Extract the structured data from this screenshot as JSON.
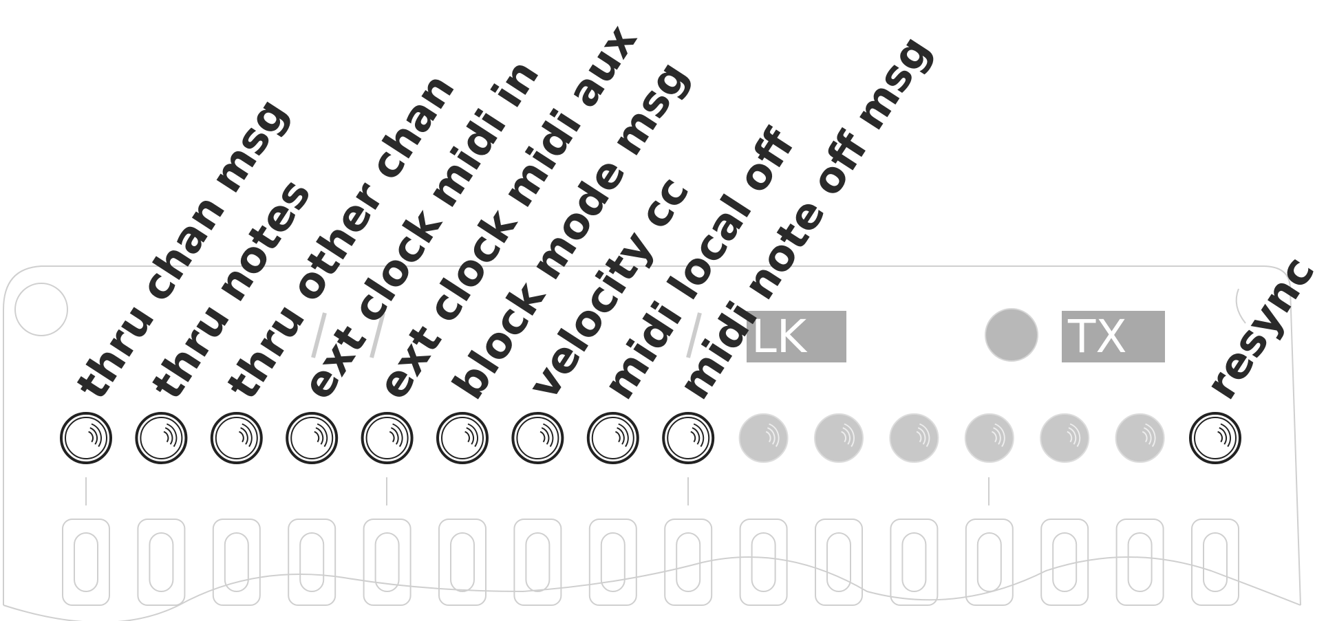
{
  "colors": {
    "outline": "#cfcfcf",
    "active_ring": "#222222",
    "inactive_fill": "#c8c8c8",
    "label": "#2a2a2a",
    "panel_box": "#a9a9a9"
  },
  "labels": [
    "thru chan msg",
    "thru notes",
    "thru other chan",
    "ext clock midi in",
    "ext clock midi aux",
    "block mode msg",
    "velocity cc",
    "midi local off",
    "midi note off msg",
    "resync"
  ],
  "panel_text": {
    "clk": "LK",
    "tx": "TX"
  },
  "buttons": {
    "active_icon": "ring-button-icon",
    "inactive_icon": "ring-button-icon"
  }
}
